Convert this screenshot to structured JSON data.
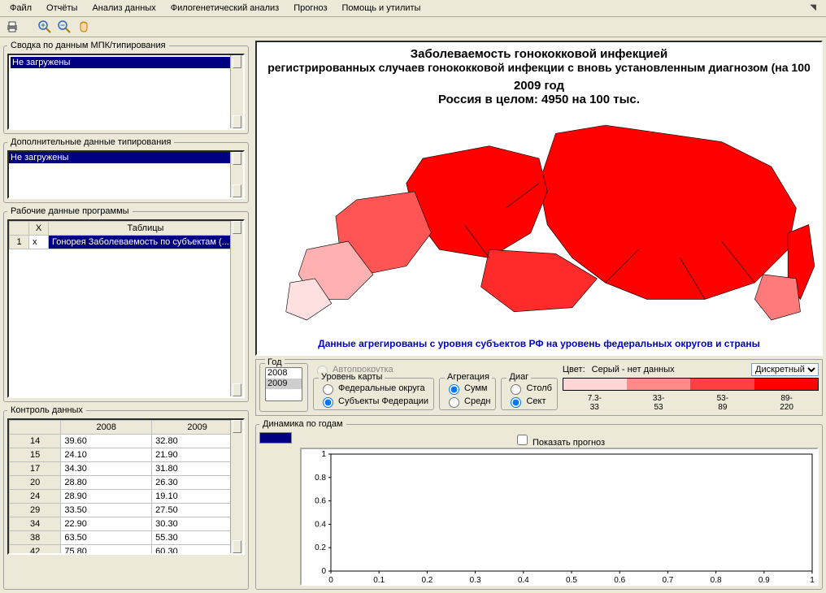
{
  "menu": {
    "items": [
      "Файл",
      "Отчёты",
      "Анализ данных",
      "Филогенетический анализ",
      "Прогноз",
      "Помощь и утилиты"
    ]
  },
  "panels": {
    "mpk": {
      "title": "Сводка по данным МПК/типирования",
      "value": "Не загружены"
    },
    "typing": {
      "title": "Дополнительные данные типирования",
      "value": "Не загружены"
    },
    "work": {
      "title": "Рабочие данные программы",
      "cols": [
        "",
        "X",
        "Таблицы"
      ],
      "row": {
        "num": "1",
        "x": "x",
        "name": "Гонорея Заболеваемость по субъектам (..."
      }
    },
    "control": {
      "title": "Контроль данных",
      "cols": [
        "",
        "2008",
        "2009"
      ],
      "rows": [
        [
          "14",
          "39.60",
          "32.80"
        ],
        [
          "15",
          "24.10",
          "21.90"
        ],
        [
          "17",
          "34.30",
          "31.80"
        ],
        [
          "20",
          "28.80",
          "26.30"
        ],
        [
          "24",
          "28.90",
          "19.10"
        ],
        [
          "29",
          "33.50",
          "27.50"
        ],
        [
          "34",
          "22.90",
          "30.30"
        ],
        [
          "38",
          "63.50",
          "55.30"
        ],
        [
          "42",
          "75.80",
          "60.30"
        ]
      ]
    }
  },
  "map": {
    "title": "Заболеваемость гонококковой инфекцией",
    "subtitle": "регистрированных случаев гонококковой инфекции с вновь установленным диагнозом (на 100",
    "year": "2009 год",
    "total": "Россия в целом: 4950 на 100 тыс.",
    "note": "Данные агрегированы с уровня субъектов РФ на уровень федеральных округов и страны"
  },
  "controls": {
    "year_label": "Год",
    "autoscroll": "Автопрокрутка",
    "years": [
      "2008",
      "2009"
    ],
    "selected_year": "2009",
    "maplevel": {
      "title": "Уровень карты",
      "opts": [
        "Федеральные округа",
        "Субъекты Федерации"
      ],
      "selected": 1
    },
    "agg": {
      "title": "Агрегация",
      "opts": [
        "Сумм",
        "Средн"
      ],
      "selected": 0
    },
    "diag": {
      "title": "Диаг",
      "opts": [
        "Столб",
        "Сект"
      ],
      "selected": 1
    },
    "color": {
      "label": "Цвет:",
      "note": "Серый - нет данных",
      "mode": "Дискретный",
      "bins": [
        "7.3-33",
        "33-53",
        "53-89",
        "89-220"
      ],
      "colors": [
        "#ffd5d5",
        "#ff8a8a",
        "#ff4040",
        "#ff0000"
      ]
    }
  },
  "dynamics": {
    "title": "Динамика по годам",
    "forecast": "Показать прогноз"
  },
  "chart_data": {
    "type": "line",
    "title": "",
    "xlabel": "",
    "ylabel": "",
    "xlim": [
      0,
      1
    ],
    "ylim": [
      0,
      1
    ],
    "x_ticks": [
      0,
      0.1,
      0.2,
      0.3,
      0.4,
      0.5,
      0.6,
      0.7,
      0.8,
      0.9,
      1
    ],
    "y_ticks": [
      0,
      0.2,
      0.4,
      0.6,
      0.8,
      1
    ],
    "series": []
  }
}
